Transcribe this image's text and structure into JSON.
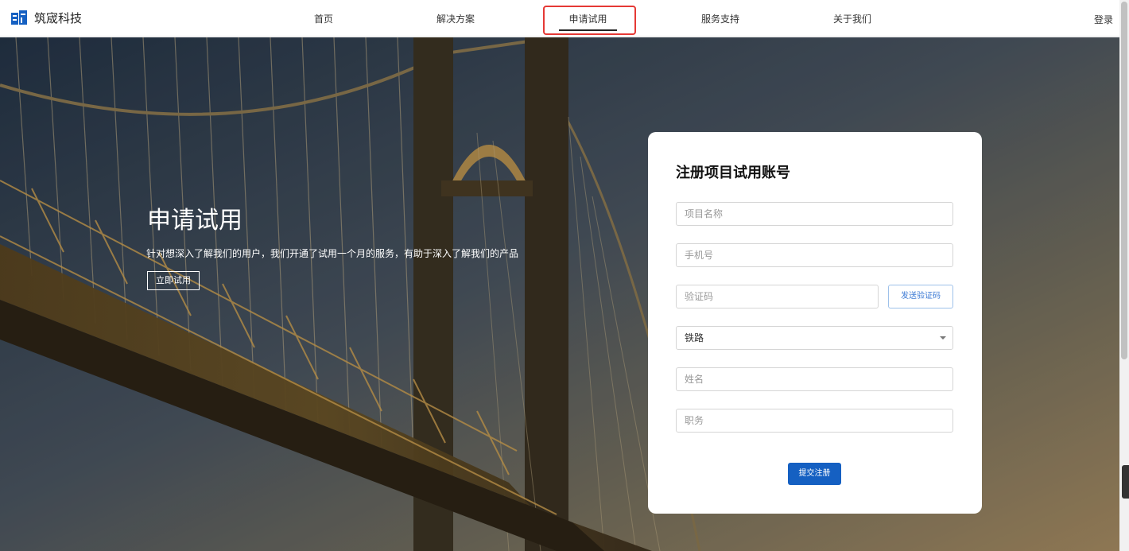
{
  "header": {
    "logo_text": "筑宬科技",
    "nav": {
      "home": "首页",
      "solutions": "解决方案",
      "trial": "申请试用",
      "support": "服务支持",
      "about": "关于我们"
    },
    "login": "登录"
  },
  "hero": {
    "title": "申请试用",
    "description": "针对想深入了解我们的用户，我们开通了试用一个月的服务，有助于深入了解我们的产品",
    "button": "立即试用"
  },
  "form": {
    "title": "注册项目试用账号",
    "project_name_placeholder": "项目名称",
    "phone_placeholder": "手机号",
    "code_placeholder": "验证码",
    "send_code": "发送验证码",
    "industry_value": "铁路",
    "name_placeholder": "姓名",
    "position_placeholder": "职务",
    "submit": "提交注册"
  },
  "colors": {
    "primary": "#1560c2",
    "highlight": "#e53935"
  }
}
